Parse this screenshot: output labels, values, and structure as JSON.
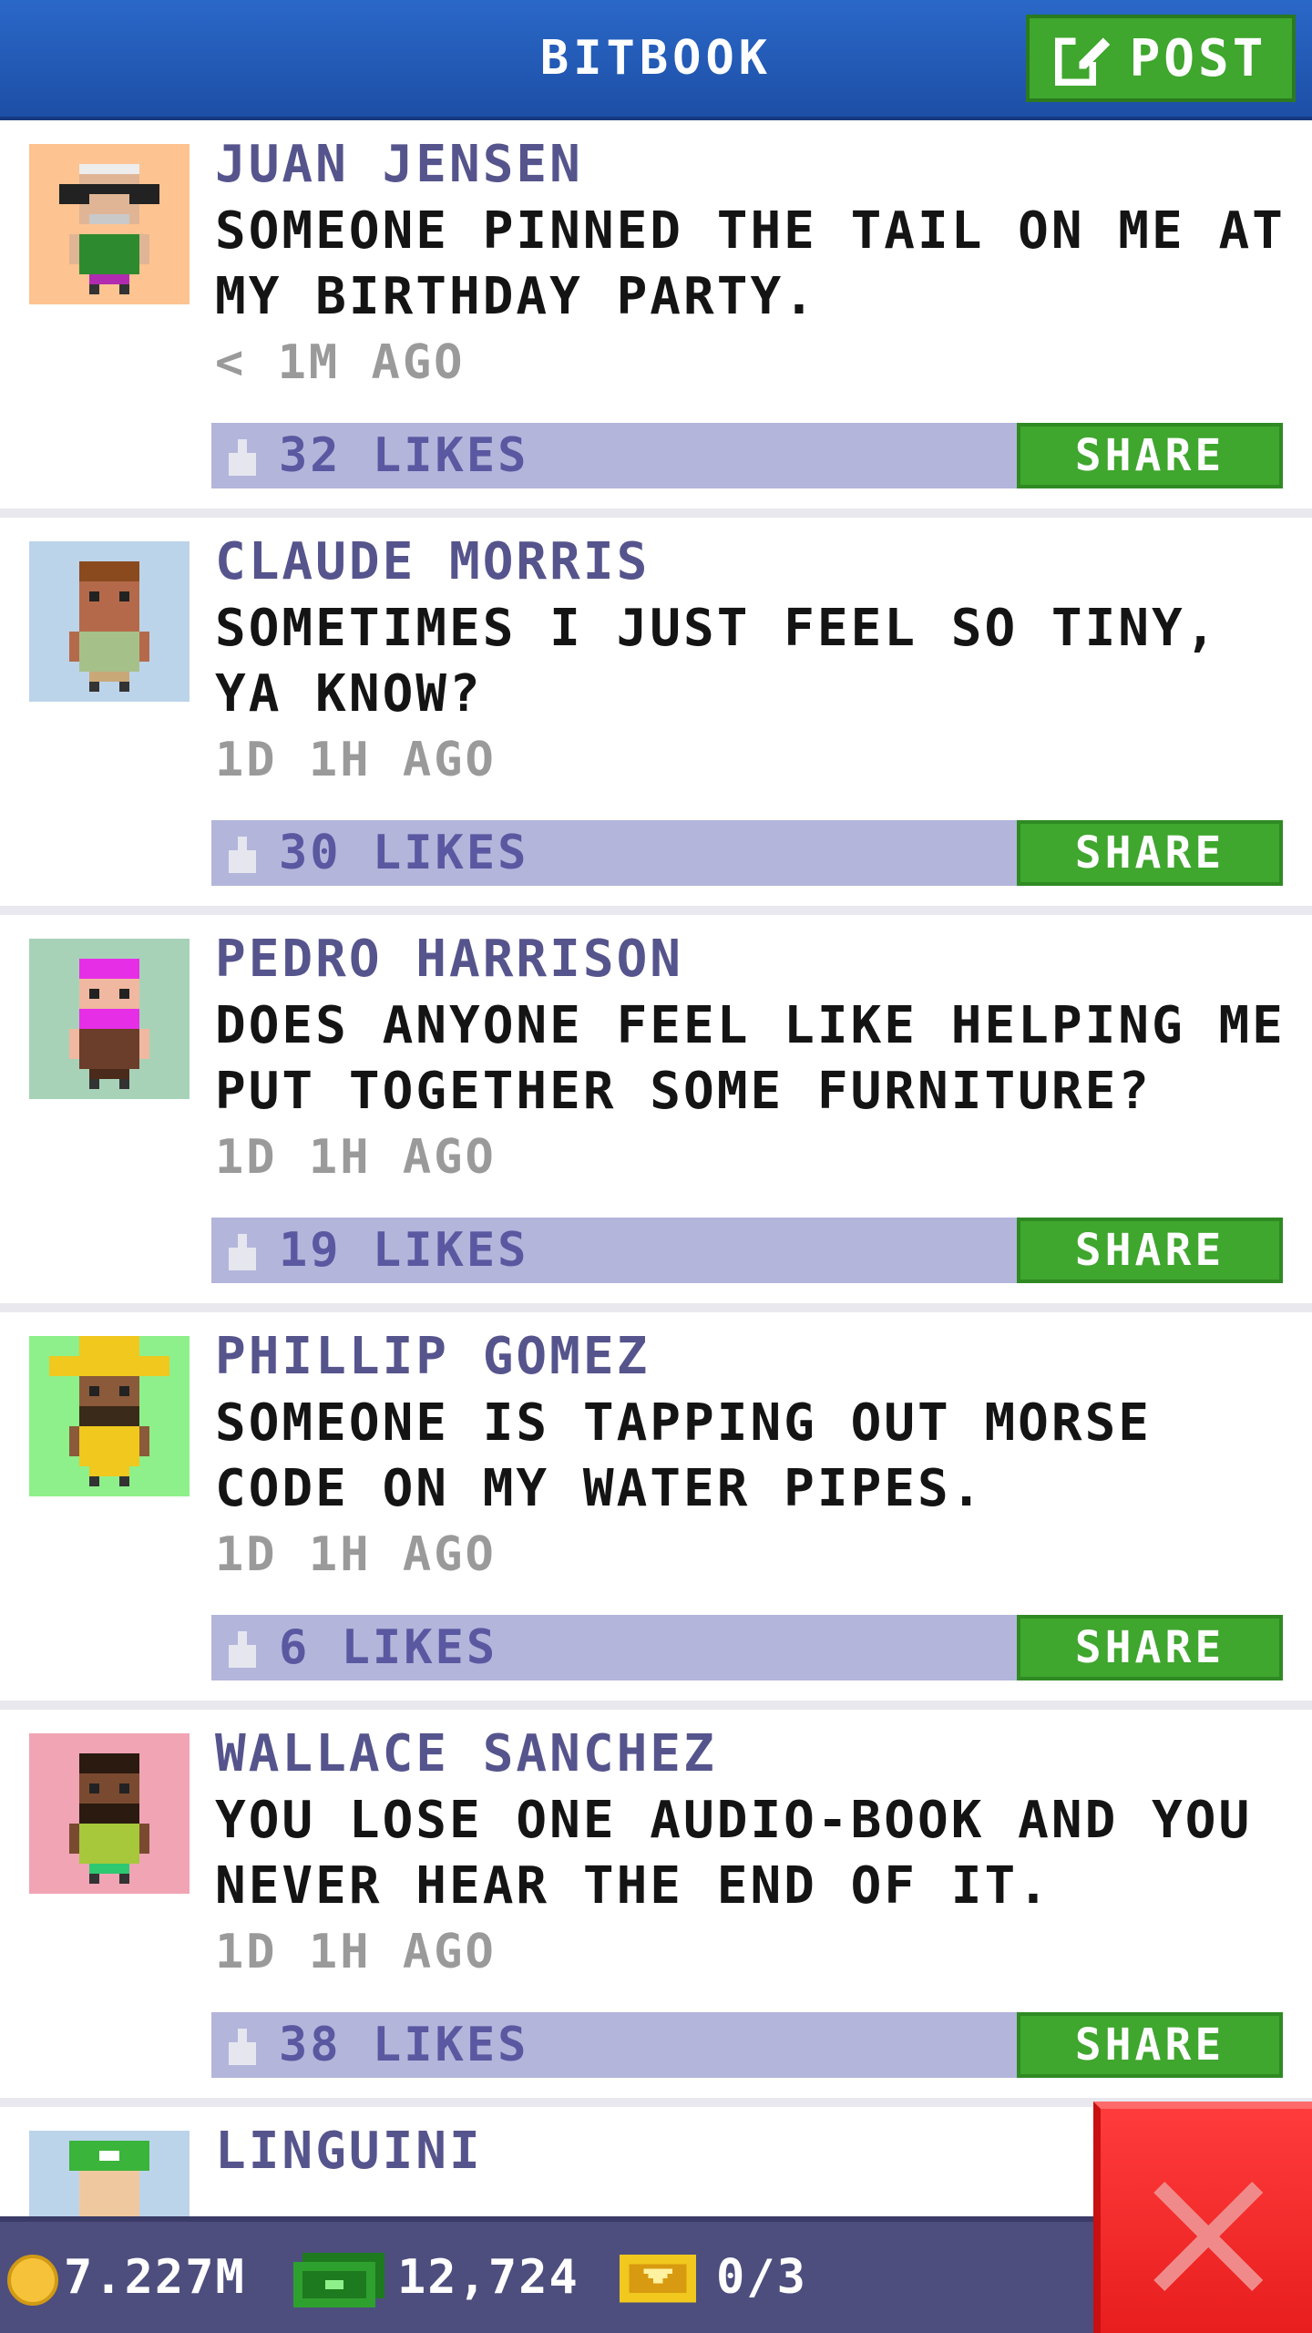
{
  "header": {
    "title": "BITBOOK",
    "post_label": "POST"
  },
  "posts": [
    {
      "author": "JUAN JENSEN",
      "text": "SOMEONE PINNED THE TAIL ON ME AT MY BIRTHDAY PARTY.",
      "time": "< 1M AGO",
      "likes": "32 LIKES",
      "share_label": "SHARE",
      "avatar_bg": "#fdc390"
    },
    {
      "author": "CLAUDE MORRIS",
      "text": "SOMETIMES I JUST FEEL SO TINY, YA KNOW?",
      "time": "1D 1H AGO",
      "likes": "30 LIKES",
      "share_label": "SHARE",
      "avatar_bg": "#bcd4ea"
    },
    {
      "author": "PEDRO HARRISON",
      "text": "DOES ANYONE FEEL LIKE HELPING ME PUT TOGETHER SOME FURNITURE?",
      "time": "1D 1H AGO",
      "likes": "19 LIKES",
      "share_label": "SHARE",
      "avatar_bg": "#a8d2b8"
    },
    {
      "author": "PHILLIP GOMEZ",
      "text": "SOMEONE IS TAPPING OUT MORSE CODE ON MY WATER PIPES.",
      "time": "1D 1H AGO",
      "likes": "6 LIKES",
      "share_label": "SHARE",
      "avatar_bg": "#8ef08a"
    },
    {
      "author": "WALLACE SANCHEZ",
      "text": "YOU LOSE ONE AUDIO-BOOK AND YOU NEVER HEAR THE END OF IT.",
      "time": "1D 1H AGO",
      "likes": "38 LIKES",
      "share_label": "SHARE",
      "avatar_bg": "#f0a4b4"
    },
    {
      "author": "LINGUINI",
      "avatar_bg": "#bcd4ea"
    }
  ],
  "footer": {
    "coins": "7.227M",
    "bux": "12,724",
    "tickets": "0/3"
  },
  "colors": {
    "header_blue": "#2a68c8",
    "button_green": "#3fa62e",
    "likes_bar": "#b3b5db",
    "close_red": "#e81e1e"
  }
}
